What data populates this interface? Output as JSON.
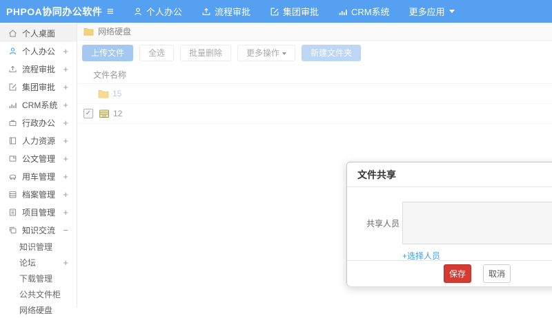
{
  "colors": {
    "header_bg": "#55a0f0",
    "accent": "#4a9cec",
    "save_red": "#d43c33"
  },
  "header": {
    "brand": "PHPOA协同办公软件",
    "nav": [
      {
        "label": "个人办公"
      },
      {
        "label": "流程审批"
      },
      {
        "label": "集团审批"
      },
      {
        "label": "CRM系统"
      },
      {
        "label": "更多应用"
      }
    ]
  },
  "sidebar": {
    "items": [
      {
        "label": "个人桌面",
        "expand": ""
      },
      {
        "label": "个人办公",
        "expand": "+"
      },
      {
        "label": "流程审批",
        "expand": "+"
      },
      {
        "label": "集团审批",
        "expand": "+"
      },
      {
        "label": "CRM系统",
        "expand": "+"
      },
      {
        "label": "行政办公",
        "expand": "+"
      },
      {
        "label": "人力资源",
        "expand": "+"
      },
      {
        "label": "公文管理",
        "expand": "+"
      },
      {
        "label": "用车管理",
        "expand": "+"
      },
      {
        "label": "档案管理",
        "expand": "+"
      },
      {
        "label": "项目管理",
        "expand": "+"
      },
      {
        "label": "知识交流",
        "expand": "−"
      }
    ],
    "subitems": [
      {
        "label": "知识管理",
        "expand": ""
      },
      {
        "label": "论坛",
        "expand": "+"
      },
      {
        "label": "下载管理",
        "expand": ""
      },
      {
        "label": "公共文件柜",
        "expand": ""
      },
      {
        "label": "网络硬盘",
        "expand": ""
      }
    ]
  },
  "main": {
    "breadcrumb": "网络硬盘",
    "toolbar": {
      "upload": "上传文件",
      "select_all": "全选",
      "batch_delete": "批量删除",
      "more_ops": "更多操作",
      "new_folder": "新建文件夹"
    },
    "table": {
      "name_header": "文件名称",
      "rows": [
        {
          "name": "15"
        },
        {
          "name": "12"
        }
      ],
      "checkbox_glyph": "✓"
    }
  },
  "modal": {
    "title": "文件共享",
    "share_label": "共享人员",
    "choose_link": "+选择人员",
    "save": "保存",
    "cancel": "取消"
  },
  "icons": {
    "hamburger": "≡"
  }
}
